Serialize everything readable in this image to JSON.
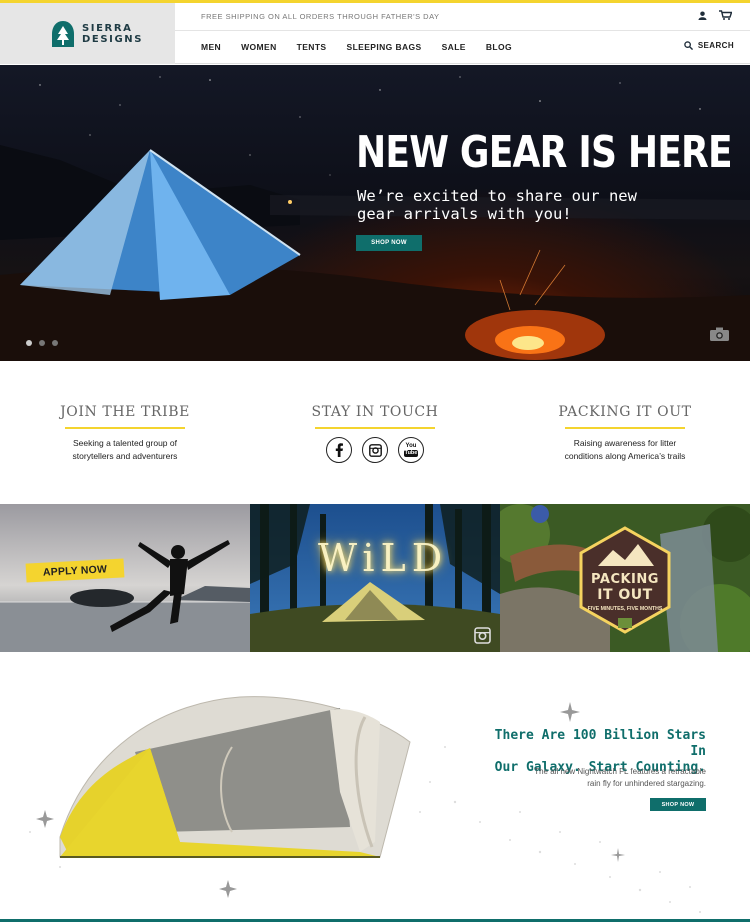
{
  "brand": {
    "name_line1": "SIERRA",
    "name_line2": "DESIGNS",
    "accent": "#f4d42f",
    "teal": "#0f6e6b"
  },
  "header": {
    "promo": "FREE SHIPPING ON ALL ORDERS THROUGH FATHER'S DAY",
    "icons": [
      "user-icon",
      "cart-icon"
    ],
    "nav": [
      "MEN",
      "WOMEN",
      "TENTS",
      "SLEEPING BAGS",
      "SALE",
      "BLOG"
    ],
    "search_label": "SEARCH"
  },
  "hero": {
    "title": "NEW GEAR IS HERE",
    "subtitle": "We’re excited to share our new gear arrivals with you!",
    "cta": "SHOP NOW",
    "slides": 3,
    "active_slide": 1
  },
  "columns": [
    {
      "title": "JOIN THE TRIBE",
      "text_line1": "Seeking a talented group of",
      "text_line2": "storytellers and adventurers"
    },
    {
      "title": "STAY IN TOUCH",
      "social": [
        "facebook-icon",
        "instagram-icon",
        "youtube-icon"
      ],
      "youtube_label_1": "You",
      "youtube_label_2": "Tube"
    },
    {
      "title": "PACKING IT OUT",
      "text_line1": "Raising awareness for litter",
      "text_line2": "conditions along America’s trails"
    }
  ],
  "tiles": {
    "apply": "APPLY NOW",
    "wild": "WiLD",
    "badge_line1": "PACKING",
    "badge_line2": "IT OUT",
    "badge_line3": "FIVE MINUTES, FIVE MONTHS"
  },
  "promo": {
    "title_line1": "There Are 100 Billion Stars In",
    "title_line2": "Our Galaxy. Start Counting.",
    "text_line1": "The all new Nightwatch FL features a retractable",
    "text_line2": "rain fly for unhindered stargazing.",
    "cta": "SHOP NOW"
  }
}
